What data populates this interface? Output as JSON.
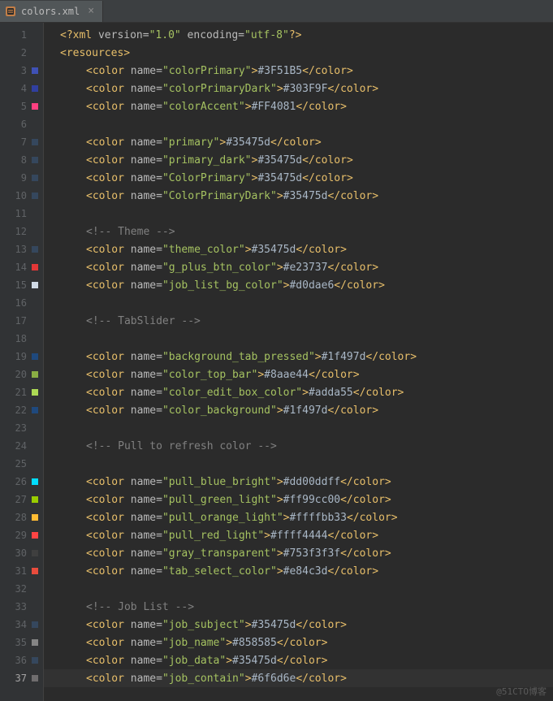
{
  "tab": {
    "filename": "colors.xml",
    "close": "×"
  },
  "watermark": "@51CTO博客",
  "xml": {
    "pi_open": "<?",
    "pi_name": "xml",
    "version_key": "version=",
    "version_val": "\"1.0\"",
    "encoding_key": "encoding=",
    "encoding_val": "\"utf-8\"",
    "pi_close": "?>",
    "res_open_l": "<",
    "res_open_r": ">",
    "res": "resources",
    "color_tag": "color",
    "name_attr": "name=",
    "open_l": "<",
    "open_r": ">",
    "close_l": "</",
    "close_r": ">",
    "cmt_open": "<!--",
    "cmt_close": "-->"
  },
  "rows": [
    {
      "n": 1,
      "kind": "pi"
    },
    {
      "n": 2,
      "kind": "res_open"
    },
    {
      "n": 3,
      "kind": "color",
      "name": "colorPrimary",
      "value": "#3F51B5",
      "swatch": "#3F51B5"
    },
    {
      "n": 4,
      "kind": "color",
      "name": "colorPrimaryDark",
      "value": "#303F9F",
      "swatch": "#303F9F"
    },
    {
      "n": 5,
      "kind": "color",
      "name": "colorAccent",
      "value": "#FF4081",
      "swatch": "#FF4081"
    },
    {
      "n": 6,
      "kind": "blank"
    },
    {
      "n": 7,
      "kind": "color",
      "name": "primary",
      "value": "#35475d",
      "swatch": "#35475d"
    },
    {
      "n": 8,
      "kind": "color",
      "name": "primary_dark",
      "value": "#35475d",
      "swatch": "#35475d"
    },
    {
      "n": 9,
      "kind": "color",
      "name": "ColorPrimary",
      "value": "#35475d",
      "swatch": "#35475d"
    },
    {
      "n": 10,
      "kind": "color",
      "name": "ColorPrimaryDark",
      "value": "#35475d",
      "swatch": "#35475d"
    },
    {
      "n": 11,
      "kind": "blank"
    },
    {
      "n": 12,
      "kind": "comment",
      "text": " Theme "
    },
    {
      "n": 13,
      "kind": "color",
      "name": "theme_color",
      "value": "#35475d",
      "swatch": "#35475d"
    },
    {
      "n": 14,
      "kind": "color",
      "name": "g_plus_btn_color",
      "value": "#e23737",
      "swatch": "#e23737"
    },
    {
      "n": 15,
      "kind": "color",
      "name": "job_list_bg_color",
      "value": "#d0dae6",
      "swatch": "#d0dae6"
    },
    {
      "n": 16,
      "kind": "blank"
    },
    {
      "n": 17,
      "kind": "comment",
      "text": " TabSlider "
    },
    {
      "n": 18,
      "kind": "blank"
    },
    {
      "n": 19,
      "kind": "color",
      "name": "background_tab_pressed",
      "value": "#1f497d",
      "swatch": "#1f497d"
    },
    {
      "n": 20,
      "kind": "color",
      "name": "color_top_bar",
      "value": "#8aae44",
      "swatch": "#8aae44"
    },
    {
      "n": 21,
      "kind": "color",
      "name": "color_edit_box_color",
      "value": "#adda55",
      "swatch": "#adda55"
    },
    {
      "n": 22,
      "kind": "color",
      "name": "color_background",
      "value": "#1f497d",
      "swatch": "#1f497d"
    },
    {
      "n": 23,
      "kind": "blank"
    },
    {
      "n": 24,
      "kind": "comment",
      "text": " Pull to refresh color "
    },
    {
      "n": 25,
      "kind": "blank"
    },
    {
      "n": 26,
      "kind": "color",
      "name": "pull_blue_bright",
      "value": "#dd00ddff",
      "swatch": "#00ddff"
    },
    {
      "n": 27,
      "kind": "color",
      "name": "pull_green_light",
      "value": "#ff99cc00",
      "swatch": "#99cc00"
    },
    {
      "n": 28,
      "kind": "color",
      "name": "pull_orange_light",
      "value": "#ffffbb33",
      "swatch": "#ffbb33"
    },
    {
      "n": 29,
      "kind": "color",
      "name": "pull_red_light",
      "value": "#ffff4444",
      "swatch": "#ff4444"
    },
    {
      "n": 30,
      "kind": "color",
      "name": "gray_transparent",
      "value": "#753f3f3f",
      "swatch": "#3f3f3f"
    },
    {
      "n": 31,
      "kind": "color",
      "name": "tab_select_color",
      "value": "#e84c3d",
      "swatch": "#e84c3d"
    },
    {
      "n": 32,
      "kind": "blank"
    },
    {
      "n": 33,
      "kind": "comment",
      "text": " Job List "
    },
    {
      "n": 34,
      "kind": "color",
      "name": "job_subject",
      "value": "#35475d",
      "swatch": "#35475d"
    },
    {
      "n": 35,
      "kind": "color",
      "name": "job_name",
      "value": "#858585",
      "swatch": "#858585"
    },
    {
      "n": 36,
      "kind": "color",
      "name": "job_data",
      "value": "#35475d",
      "swatch": "#35475d"
    },
    {
      "n": 37,
      "kind": "color",
      "name": "job_contain",
      "value": "#6f6d6e",
      "swatch": "#6f6d6e",
      "current": true
    }
  ]
}
